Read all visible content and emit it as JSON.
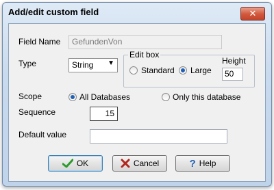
{
  "window": {
    "title": "Add/edit custom field",
    "close_glyph": "✕"
  },
  "fields": {
    "field_name": {
      "label": "Field Name",
      "value": "GefundenVon"
    },
    "type": {
      "label": "Type",
      "value": "String"
    },
    "edit_box": {
      "legend": "Edit box",
      "standard_label": "Standard",
      "large_label": "Large",
      "selected": "Large",
      "height_label": "Height",
      "height_value": "50"
    },
    "scope": {
      "label": "Scope",
      "all_label": "All Databases",
      "only_label": "Only this database",
      "selected": "All Databases"
    },
    "sequence": {
      "label": "Sequence",
      "value": "15"
    },
    "default_value": {
      "label": "Default value",
      "value": ""
    }
  },
  "buttons": {
    "ok": {
      "label": "OK",
      "icon": "check-icon",
      "color": "#2b9a2b"
    },
    "cancel": {
      "label": "Cancel",
      "icon": "x-icon",
      "color": "#b3261e"
    },
    "help": {
      "label": "Help",
      "icon": "question-icon",
      "color": "#1f5fb8"
    }
  }
}
